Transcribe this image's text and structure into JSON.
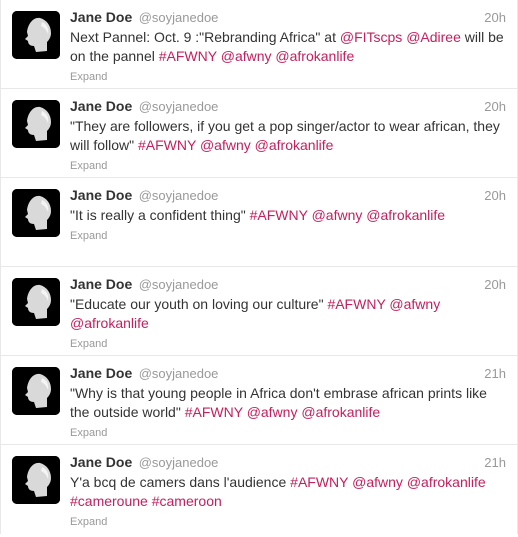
{
  "colors": {
    "link": "#c3205d",
    "muted": "#999999",
    "text": "#333333",
    "divider": "#e8e8e8"
  },
  "icons": {
    "avatar": "silhouette-profile-photo"
  },
  "tweets": [
    {
      "name": "Jane Doe",
      "username": "@soyjanedoe",
      "time": "20h",
      "expand": "Expand",
      "segments": [
        {
          "t": "Next Pannel: Oct. 9 :\"Rebranding Africa\" at ",
          "link": false
        },
        {
          "t": "@FITscps",
          "link": true
        },
        {
          "t": " ",
          "link": false
        },
        {
          "t": "@Adiree",
          "link": true
        },
        {
          "t": " will be on the pannel ",
          "link": false
        },
        {
          "t": "#AFWNY",
          "link": true
        },
        {
          "t": " ",
          "link": false
        },
        {
          "t": "@afwny",
          "link": true
        },
        {
          "t": " ",
          "link": false
        },
        {
          "t": "@afrokanlife",
          "link": true
        }
      ]
    },
    {
      "name": "Jane Doe",
      "username": "@soyjanedoe",
      "time": "20h",
      "expand": "Expand",
      "segments": [
        {
          "t": "\"They are followers, if you get a pop singer/actor to wear african, they will follow\" ",
          "link": false
        },
        {
          "t": "#AFWNY",
          "link": true
        },
        {
          "t": " ",
          "link": false
        },
        {
          "t": "@afwny",
          "link": true
        },
        {
          "t": " ",
          "link": false
        },
        {
          "t": "@afrokanlife",
          "link": true
        }
      ]
    },
    {
      "name": "Jane Doe",
      "username": "@soyjanedoe",
      "time": "20h",
      "expand": "Expand",
      "segments": [
        {
          "t": "\"It is really a confident thing\" ",
          "link": false
        },
        {
          "t": "#AFWNY",
          "link": true
        },
        {
          "t": " ",
          "link": false
        },
        {
          "t": "@afwny",
          "link": true
        },
        {
          "t": " ",
          "link": false
        },
        {
          "t": "@afrokanlife",
          "link": true
        }
      ]
    },
    {
      "name": "Jane Doe",
      "username": "@soyjanedoe",
      "time": "20h",
      "expand": "Expand",
      "segments": [
        {
          "t": "\"Educate our youth on loving our culture\" ",
          "link": false
        },
        {
          "t": "#AFWNY",
          "link": true
        },
        {
          "t": " ",
          "link": false
        },
        {
          "t": "@afwny",
          "link": true
        },
        {
          "t": " ",
          "link": false
        },
        {
          "t": "@afrokanlife",
          "link": true
        }
      ]
    },
    {
      "name": "Jane Doe",
      "username": "@soyjanedoe",
      "time": "21h",
      "expand": "Expand",
      "segments": [
        {
          "t": "\"Why is that young people in Africa don't embrase african prints like the outside world\" ",
          "link": false
        },
        {
          "t": "#AFWNY",
          "link": true
        },
        {
          "t": " ",
          "link": false
        },
        {
          "t": "@afwny",
          "link": true
        },
        {
          "t": " ",
          "link": false
        },
        {
          "t": "@afrokanlife",
          "link": true
        }
      ]
    },
    {
      "name": "Jane Doe",
      "username": "@soyjanedoe",
      "time": "21h",
      "expand": "Expand",
      "segments": [
        {
          "t": "Y'a bcq de camers dans l'audience ",
          "link": false
        },
        {
          "t": "#AFWNY",
          "link": true
        },
        {
          "t": " ",
          "link": false
        },
        {
          "t": "@afwny",
          "link": true
        },
        {
          "t": " ",
          "link": false
        },
        {
          "t": "@afrokanlife",
          "link": true
        },
        {
          "t": " ",
          "link": false
        },
        {
          "t": "#cameroune",
          "link": true
        },
        {
          "t": " ",
          "link": false
        },
        {
          "t": "#cameroon",
          "link": true
        }
      ]
    }
  ]
}
